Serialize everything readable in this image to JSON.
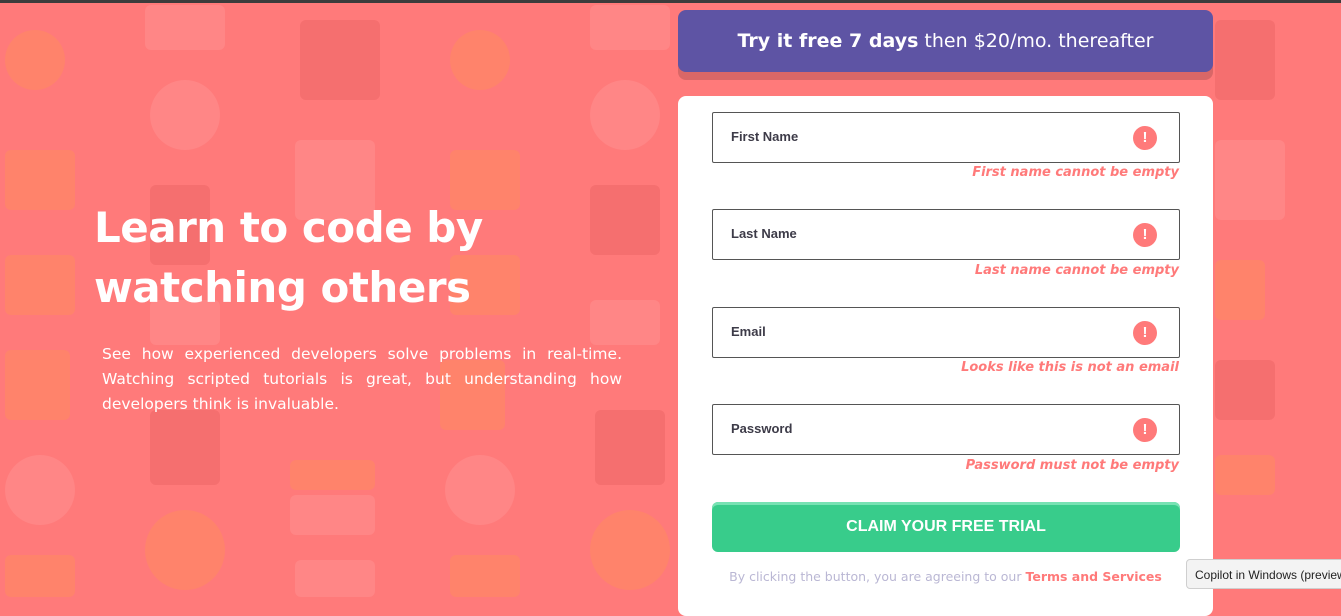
{
  "hero": {
    "title": "Learn to code by watching others",
    "description": "See how experienced developers solve problems in real-time. Watching scripted tutorials is great, but understanding how developers think is invaluable."
  },
  "promo": {
    "bold": "Try it free 7 days",
    "rest": " then $20/mo. thereafter"
  },
  "form": {
    "first_name": {
      "placeholder": "First Name",
      "value": "",
      "error": "First name cannot be empty"
    },
    "last_name": {
      "placeholder": "Last Name",
      "value": "",
      "error": "Last name cannot be empty"
    },
    "email": {
      "placeholder": "Email",
      "value": "",
      "error": "Looks like this is not an email"
    },
    "password": {
      "placeholder": "Password",
      "value": "",
      "error": "Password must not be empty"
    },
    "error_icon": "!",
    "submit_label": "CLAIM YOUR FREE TRIAL",
    "terms_prefix": "By clicking the button, you are agreeing to our ",
    "terms_link": "Terms and Services"
  },
  "tooltip": "Copilot in Windows (preview)",
  "colors": {
    "background": "#ff7a7a",
    "promo": "#5e54a4",
    "cta": "#38cc8b",
    "error": "#ff7a7a"
  }
}
